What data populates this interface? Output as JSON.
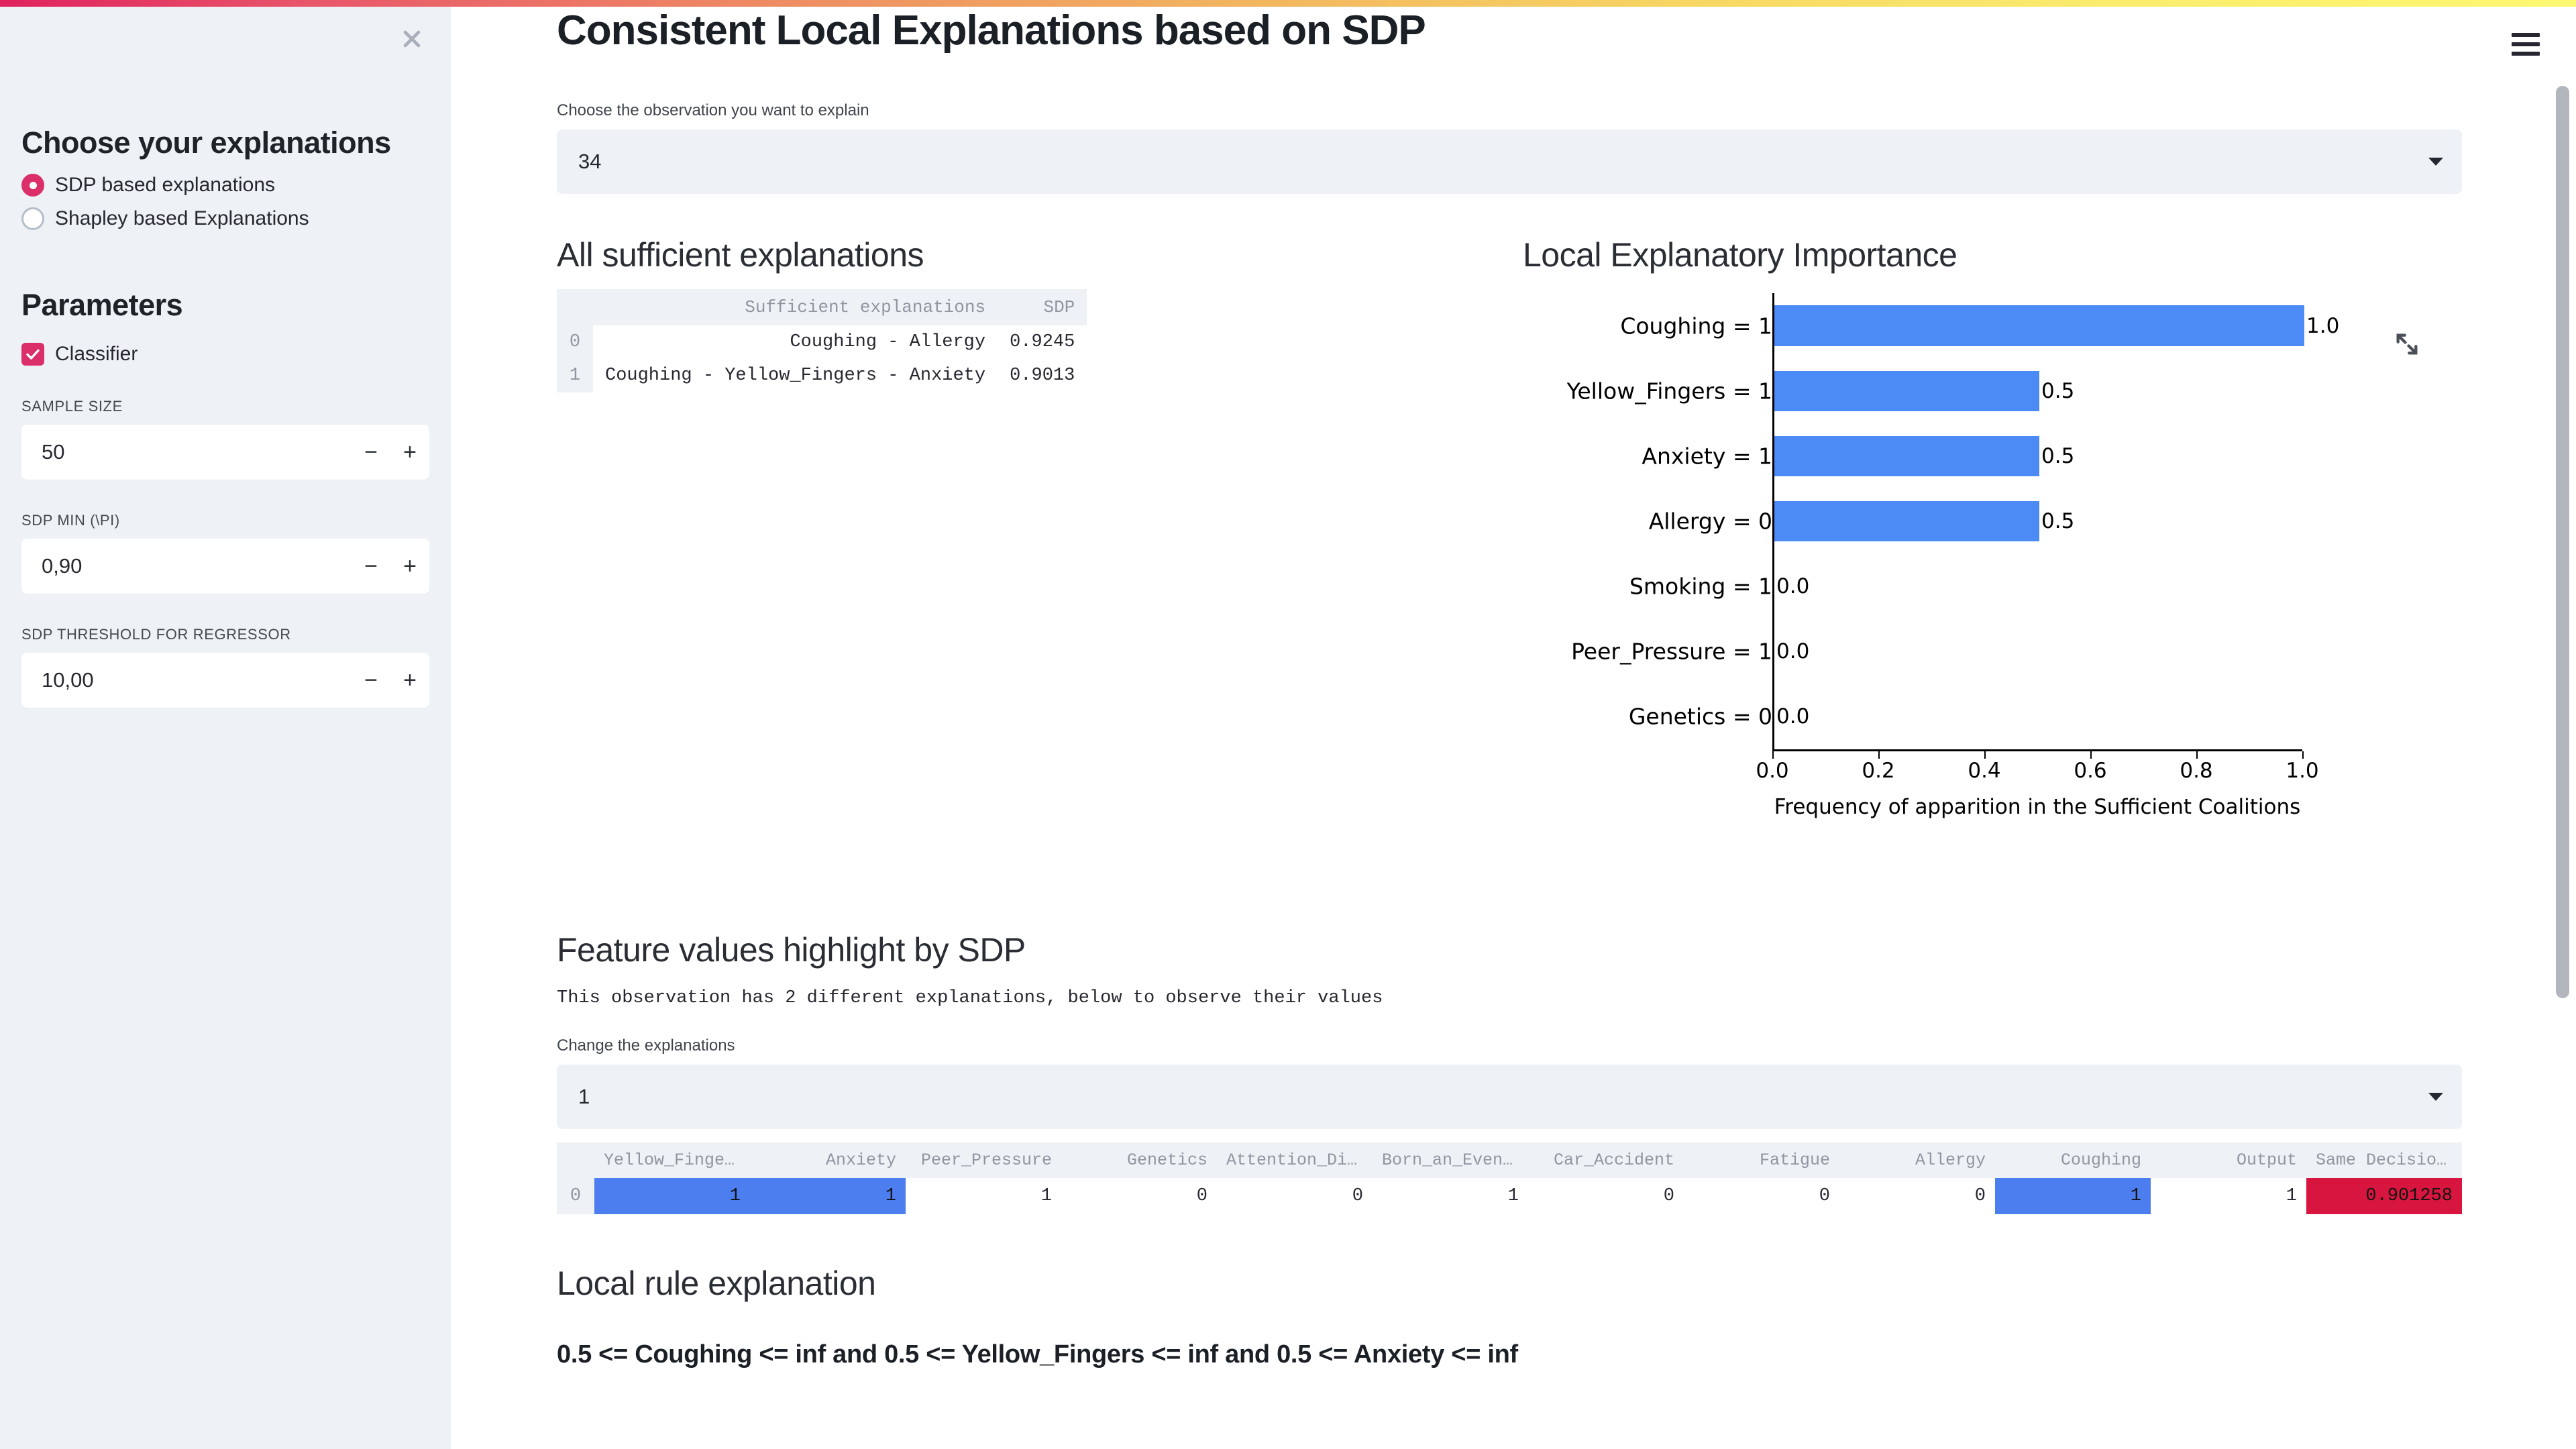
{
  "sidebar": {
    "close_icon": "close-icon",
    "heading": "Choose your explanations",
    "radio_options": [
      {
        "label": "SDP based explanations",
        "checked": true
      },
      {
        "label": "Shapley based Explanations",
        "checked": false
      }
    ],
    "parameters_heading": "Parameters",
    "classifier": {
      "label": "Classifier",
      "checked": true
    },
    "number_fields": [
      {
        "label": "SAMPLE SIZE",
        "value": "50",
        "minus": "−",
        "plus": "+"
      },
      {
        "label": "SDP MIN (\\pi)",
        "value": "0,90",
        "minus": "−",
        "plus": "+"
      },
      {
        "label": "SDP THRESHOLD FOR REGRESSOR",
        "value": "10,00",
        "minus": "−",
        "plus": "+"
      }
    ]
  },
  "header": {
    "title": "Consistent Local Explanations based on SDP",
    "menu_icon": "hamburger-menu-icon"
  },
  "observation": {
    "label": "Choose the observation you want to explain",
    "value": "34"
  },
  "sufficient": {
    "title": "All sufficient explanations",
    "columns": [
      "",
      "Sufficient explanations",
      "SDP"
    ],
    "rows": [
      {
        "index": "0",
        "explanation": "Coughing - Allergy",
        "sdp": "0.9245"
      },
      {
        "index": "1",
        "explanation": "Coughing - Yellow_Fingers - Anxiety",
        "sdp": "0.9013"
      }
    ]
  },
  "importance": {
    "title": "Local Explanatory Importance",
    "expand_icon": "fullscreen-expand-icon"
  },
  "chart_data": {
    "type": "bar",
    "orientation": "horizontal",
    "title": "Local Explanatory Importance",
    "categories": [
      "Coughing = 1",
      "Yellow_Fingers = 1",
      "Anxiety = 1",
      "Allergy = 0",
      "Smoking = 1",
      "Peer_Pressure = 1",
      "Genetics = 0"
    ],
    "values": [
      1.0,
      0.5,
      0.5,
      0.5,
      0.0,
      0.0,
      0.0
    ],
    "value_labels": [
      "1.0",
      "0.5",
      "0.5",
      "0.5",
      "0.0",
      "0.0",
      "0.0"
    ],
    "xlabel": "Frequency of apparition in the Sufficient Coalitions",
    "ylabel": "",
    "xlim": [
      0.0,
      1.0
    ],
    "xticks": [
      "0.0",
      "0.2",
      "0.4",
      "0.6",
      "0.8",
      "1.0"
    ],
    "grid": false,
    "legend": null,
    "bar_color": "#4c8bf5"
  },
  "feature_values": {
    "title": "Feature values highlight by SDP",
    "description": "This observation has 2 different explanations, below to observe their values",
    "change_label": "Change the explanations",
    "change_value": "1",
    "columns": [
      "",
      "Yellow_Fingers",
      "Anxiety",
      "Peer_Pressure",
      "Genetics",
      "Attention_Disorder",
      "Born_an_Even_Day",
      "Car_Accident",
      "Fatigue",
      "Allergy",
      "Coughing",
      "Output",
      "Same Decision Probabil…"
    ],
    "row": {
      "index": "0",
      "cells": [
        {
          "value": "1",
          "highlight": "blue"
        },
        {
          "value": "1",
          "highlight": "blue"
        },
        {
          "value": "1",
          "highlight": "none"
        },
        {
          "value": "0",
          "highlight": "none"
        },
        {
          "value": "0",
          "highlight": "none"
        },
        {
          "value": "1",
          "highlight": "none"
        },
        {
          "value": "0",
          "highlight": "none"
        },
        {
          "value": "0",
          "highlight": "none"
        },
        {
          "value": "0",
          "highlight": "none"
        },
        {
          "value": "1",
          "highlight": "blue"
        },
        {
          "value": "1",
          "highlight": "none"
        },
        {
          "value": "0.901258",
          "highlight": "red"
        }
      ]
    }
  },
  "local_rule": {
    "title": "Local rule explanation",
    "rule": "0.5 <= Coughing <= inf and 0.5 <= Yellow_Fingers <= inf and 0.5 <= Anxiety <= inf"
  },
  "colors": {
    "accent_pink": "#db2f6a",
    "bar_blue": "#4c8bf5",
    "highlight_blue": "#4c7ef0",
    "highlight_red": "#d8153e",
    "sidebar_bg": "#eef1f5"
  }
}
